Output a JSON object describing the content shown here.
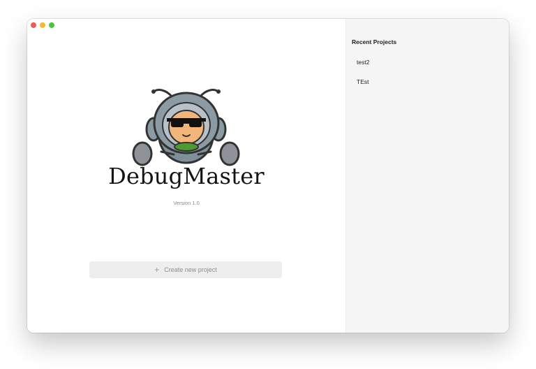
{
  "window": {
    "controls": [
      "close",
      "minimize",
      "maximize"
    ]
  },
  "main": {
    "app_name": "DebugMaster",
    "version": "Version 1.0",
    "create_button": {
      "icon": "plus-icon",
      "label": "Create new project"
    },
    "logo_icon": "ant-mascot-icon"
  },
  "sidebar": {
    "title": "Recent Projects",
    "projects": [
      {
        "name": "test2"
      },
      {
        "name": "TEst"
      }
    ]
  },
  "colors": {
    "sidebar_bg": "#f5f5f5",
    "button_bg": "#eeeeee",
    "close": "#ee5b56",
    "minimize": "#f4bd2f",
    "maximize": "#45c93b"
  }
}
